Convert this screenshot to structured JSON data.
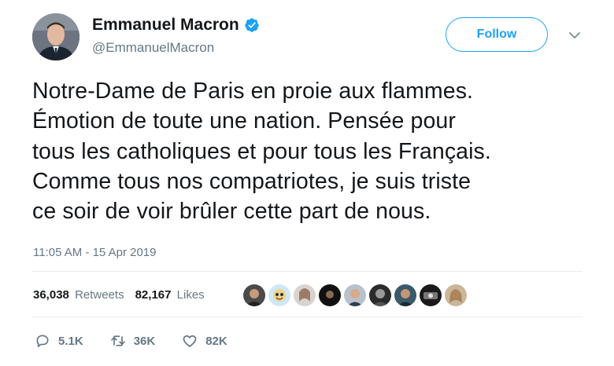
{
  "author": {
    "name": "Emmanuel Macron",
    "handle": "@EmmanuelMacron",
    "verified": true
  },
  "follow_button": {
    "label": "Follow"
  },
  "tweet": {
    "text": "Notre-Dame de Paris en proie aux flammes.\nÉmotion de toute une nation. Pensée pour\ntous les catholiques et pour tous les Français.\nComme tous nos compatriotes, je suis triste\nce soir de voir brûler cette part de nous.",
    "timestamp": "11:05 AM - 15 Apr 2019"
  },
  "stats": {
    "retweets_count": "36,038",
    "retweets_label": "Retweets",
    "likes_count": "82,167",
    "likes_label": "Likes"
  },
  "actions": {
    "reply_count": "5.1K",
    "retweet_count": "36K",
    "like_count": "82K"
  },
  "colors": {
    "accent": "#1da1f2",
    "text": "#14171a",
    "muted": "#657786",
    "divider": "#e6ecf0"
  },
  "icons": [
    "verified-badge-icon",
    "chevron-down-icon",
    "reply-icon",
    "retweet-icon",
    "heart-icon"
  ]
}
